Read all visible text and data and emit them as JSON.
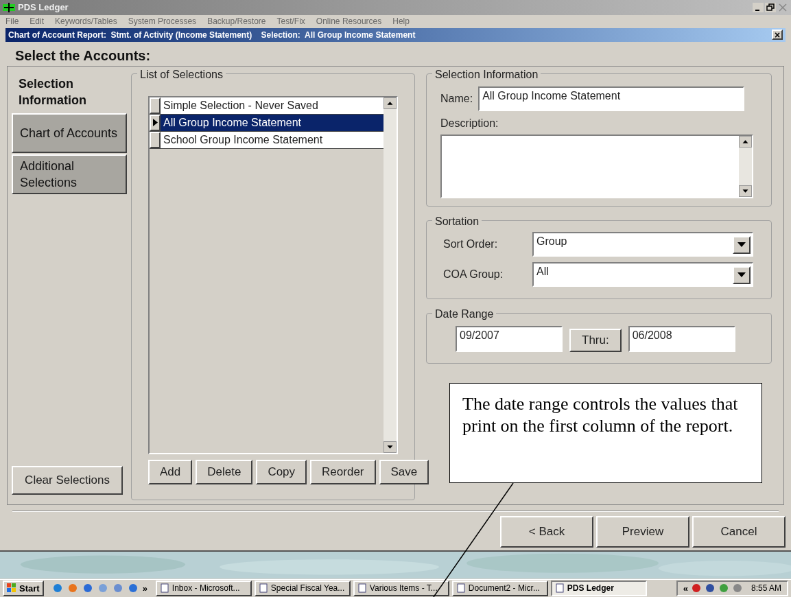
{
  "window": {
    "title": "PDS Ledger"
  },
  "menu": [
    "File",
    "Edit",
    "Keywords/Tables",
    "System Processes",
    "Backup/Restore",
    "Test/Fix",
    "Online Resources",
    "Help"
  ],
  "dialog": {
    "title": "Chart of Account Report:  Stmt. of Activity (Income Statement)    Selection:  All Group Income Statement",
    "close": "×"
  },
  "heading": "Select the Accounts:",
  "side_tabs": [
    {
      "label": "Selection Information",
      "selected": true
    },
    {
      "label": "Chart of Accounts",
      "selected": false
    },
    {
      "label": "Additional Selections",
      "selected": false
    }
  ],
  "clear_button": "Clear Selections",
  "list_of_selections": {
    "title": "List of Selections",
    "rows": [
      {
        "label": "Simple Selection - Never Saved",
        "selected": false
      },
      {
        "label": "All Group Income Statement",
        "selected": true
      },
      {
        "label": "School Group Income Statement",
        "selected": false
      }
    ],
    "buttons": [
      "Add",
      "Delete",
      "Copy",
      "Reorder",
      "Save"
    ]
  },
  "selection_information": {
    "title": "Selection Information",
    "name_label": "Name:",
    "name_value": "All Group Income Statement",
    "description_label": "Description:"
  },
  "sortation": {
    "title": "Sortation",
    "fields": [
      {
        "label": "Sort Order:",
        "value": "Group"
      },
      {
        "label": "COA Group:",
        "value": "All"
      }
    ]
  },
  "date_range": {
    "title": "Date Range",
    "from": "09/2007",
    "thru_button": "Thru:",
    "to": "06/2008"
  },
  "callout": "The date range controls the values that print on the first column of the report.",
  "footer_buttons": [
    "< Back",
    "Preview",
    "Cancel"
  ],
  "taskbar": {
    "start": "Start",
    "more": "»",
    "tasks": [
      {
        "label": "Inbox - Microsoft...",
        "selected": false
      },
      {
        "label": "Special Fiscal Yea...",
        "selected": false
      },
      {
        "label": "Various Items - T...",
        "selected": false
      },
      {
        "label": "Document2 - Micr...",
        "selected": false
      },
      {
        "label": "PDS Ledger",
        "selected": true
      }
    ],
    "tray_expand": "«",
    "clock": "8:55 AM"
  }
}
